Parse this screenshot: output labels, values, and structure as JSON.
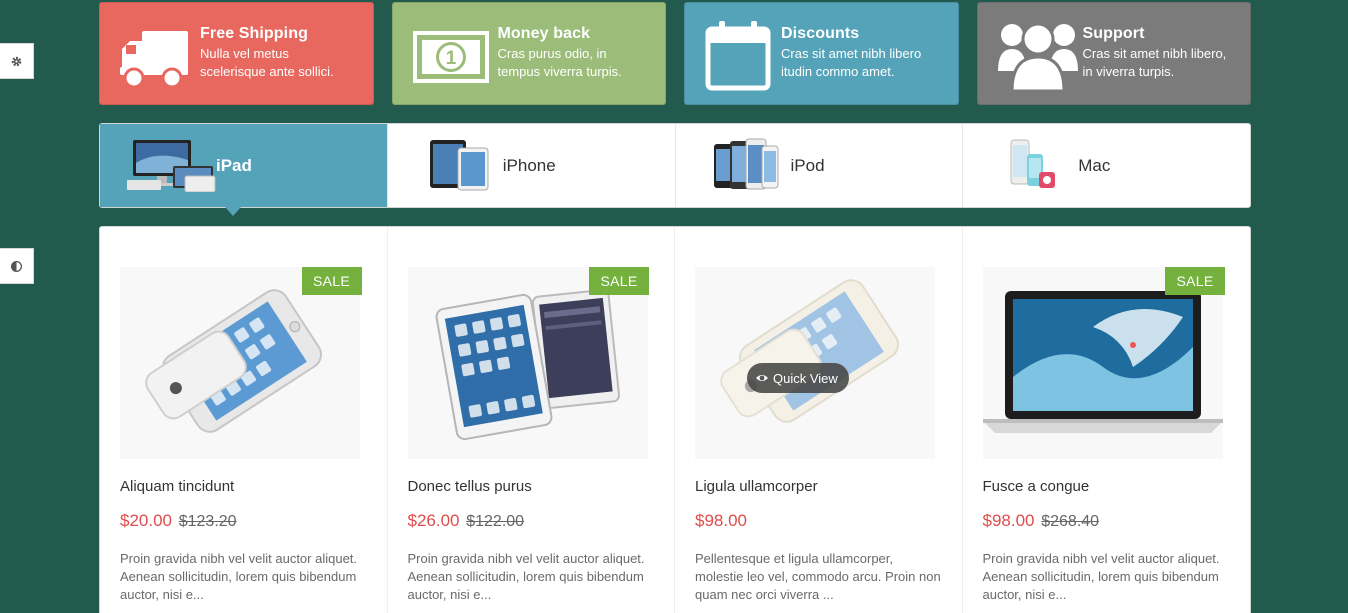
{
  "features": [
    {
      "title": "Free Shipping",
      "desc1": "Nulla vel metus",
      "desc2": "scelerisque ante sollici.",
      "color": "#e8685f",
      "icon": "truck-icon"
    },
    {
      "title": "Money back",
      "desc1": "Cras purus odio, in",
      "desc2": "tempus viverra turpis.",
      "color": "#9bbd79",
      "icon": "money-icon"
    },
    {
      "title": "Discounts",
      "desc1": "Cras sit amet nibh libero",
      "desc2": "itudin commo amet.",
      "color": "#55a3b8",
      "icon": "calendar-icon"
    },
    {
      "title": "Support",
      "desc1": "Cras sit amet nibh libero,",
      "desc2": "in viverra turpis.",
      "color": "#7b7b7b",
      "icon": "users-icon"
    }
  ],
  "tabs": [
    {
      "label": "iPad",
      "active": true
    },
    {
      "label": "iPhone",
      "active": false
    },
    {
      "label": "iPod",
      "active": false
    },
    {
      "label": "Mac",
      "active": false
    }
  ],
  "products": [
    {
      "name": "Aliquam tincidunt",
      "price": "$20.00",
      "old_price": "$123.20",
      "sale": "SALE",
      "desc": "Proin gravida nibh vel velit auctor aliquet. Aenean sollicitudin, lorem quis bibendum auctor, nisi e...",
      "image": "iphone-white"
    },
    {
      "name": "Donec tellus purus",
      "price": "$26.00",
      "old_price": "$122.00",
      "sale": "SALE",
      "desc": "Proin gravida nibh vel velit auctor aliquet. Aenean sollicitudin, lorem quis bibendum auctor, nisi e...",
      "image": "ipad-pair"
    },
    {
      "name": "Ligula ullamcorper",
      "price": "$98.00",
      "old_price": "",
      "sale": "",
      "desc": "Pellentesque et ligula ullamcorper, molestie leo vel, commodo arcu. Proin non quam nec orci viverra ...",
      "image": "iphone-gold",
      "quick_view": "Quick View"
    },
    {
      "name": "Fusce a congue",
      "price": "$98.00",
      "old_price": "$268.40",
      "sale": "SALE",
      "desc": "Proin gravida nibh vel velit auctor aliquet. Aenean sollicitudin, lorem quis bibendum auctor, nisi e...",
      "image": "macbook"
    }
  ],
  "colors": {
    "background": "#225b4d",
    "accent": "#55a3b8",
    "sale": "#74b23d",
    "price": "#e14b4b"
  }
}
